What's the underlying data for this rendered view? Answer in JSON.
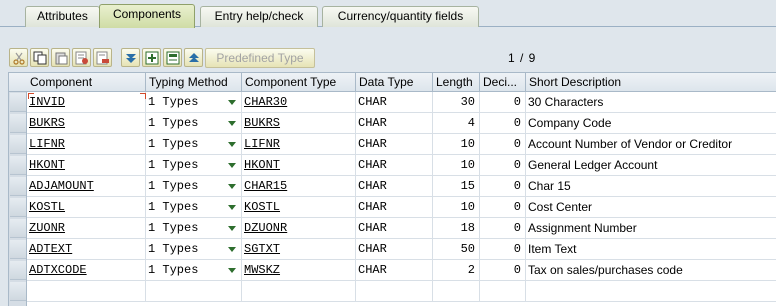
{
  "tabs": [
    {
      "label": "Attributes",
      "active": false
    },
    {
      "label": "Components",
      "active": true
    },
    {
      "label": "Entry help/check",
      "active": false
    },
    {
      "label": "Currency/quantity fields",
      "active": false
    }
  ],
  "toolbar": {
    "icons": [
      "cut-icon",
      "copy-icon",
      "paste-icon",
      "insert-row-icon",
      "delete-row-icon",
      "scroll-down-icon",
      "insert-icon",
      "append-icon",
      "scroll-up-icon"
    ],
    "predefined_type_label": "Predefined Type",
    "pager": "1 / 9"
  },
  "table": {
    "columns": [
      "Component",
      "Typing Method",
      "Component Type",
      "Data Type",
      "Length",
      "Deci...",
      "Short Description"
    ],
    "rows": [
      {
        "component": "INVID",
        "typing": "1 Types",
        "ctype": "CHAR30",
        "dtype": "CHAR",
        "length": "30",
        "decimals": "0",
        "desc": "30 Characters"
      },
      {
        "component": "BUKRS",
        "typing": "1 Types",
        "ctype": "BUKRS",
        "dtype": "CHAR",
        "length": "4",
        "decimals": "0",
        "desc": "Company Code"
      },
      {
        "component": "LIFNR",
        "typing": "1 Types",
        "ctype": "LIFNR",
        "dtype": "CHAR",
        "length": "10",
        "decimals": "0",
        "desc": "Account Number of Vendor or Creditor"
      },
      {
        "component": "HKONT",
        "typing": "1 Types",
        "ctype": "HKONT",
        "dtype": "CHAR",
        "length": "10",
        "decimals": "0",
        "desc": "General Ledger Account"
      },
      {
        "component": "ADJAMOUNT",
        "typing": "1 Types",
        "ctype": "CHAR15",
        "dtype": "CHAR",
        "length": "15",
        "decimals": "0",
        "desc": "Char 15"
      },
      {
        "component": "KOSTL",
        "typing": "1 Types",
        "ctype": "KOSTL",
        "dtype": "CHAR",
        "length": "10",
        "decimals": "0",
        "desc": "Cost Center"
      },
      {
        "component": "ZUONR",
        "typing": "1 Types",
        "ctype": "DZUONR",
        "dtype": "CHAR",
        "length": "18",
        "decimals": "0",
        "desc": "Assignment Number"
      },
      {
        "component": "ADTEXT",
        "typing": "1 Types",
        "ctype": "SGTXT",
        "dtype": "CHAR",
        "length": "50",
        "decimals": "0",
        "desc": "Item Text"
      },
      {
        "component": "ADTXCODE",
        "typing": "1 Types",
        "ctype": "MWSKZ",
        "dtype": "CHAR",
        "length": "2",
        "decimals": "0",
        "desc": "Tax on sales/purchases code"
      }
    ]
  }
}
